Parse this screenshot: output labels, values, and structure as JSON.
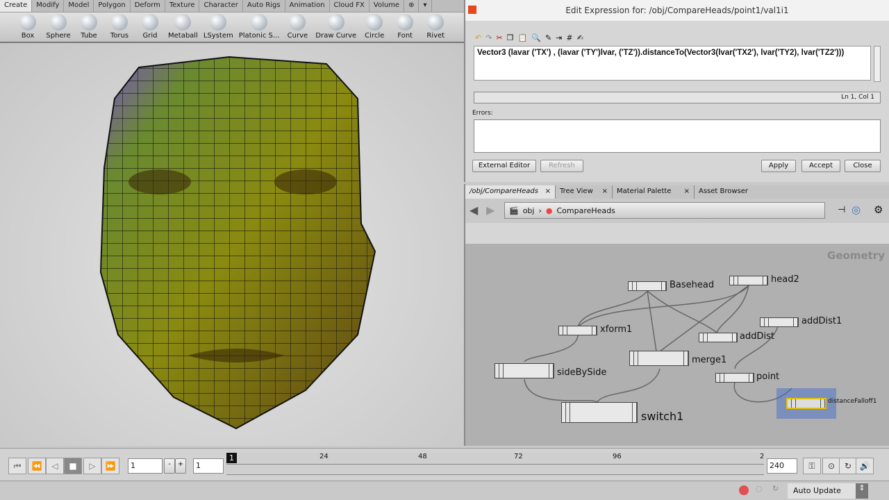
{
  "shelf": {
    "tabs": [
      "Create",
      "Modify",
      "Model",
      "Polygon",
      "Deform",
      "Texture",
      "Character",
      "Auto Rigs",
      "Animation",
      "Cloud FX",
      "Volume"
    ],
    "tools": [
      "Box",
      "Sphere",
      "Tube",
      "Torus",
      "Grid",
      "Metaball",
      "LSystem",
      "Platonic S...",
      "Curve",
      "Draw Curve",
      "Circle",
      "Font",
      "Rivet"
    ]
  },
  "expression_editor": {
    "title": "Edit Expression for: /obj/CompareHeads/point1/val1i1",
    "expression": "Vector3 (lavar ('TX') , (lavar ('TY')lvar, ('TZ')).distanceTo(Vector3(lvar('TX2'), lvar('TY2), lvar('TZ2')))",
    "cursor_status": "Ln 1, Col 1",
    "errors_label": "Errors:",
    "errors": "",
    "buttons": {
      "external_editor": "External Editor",
      "refresh": "Refresh",
      "apply": "Apply",
      "accept": "Accept",
      "close": "Close"
    }
  },
  "network": {
    "tabs": [
      "/obj/CompareHeads",
      "Tree View",
      "Material Palette",
      "Asset Browser"
    ],
    "path": [
      "obj",
      "CompareHeads"
    ],
    "context_label": "Geometry",
    "nodes": [
      {
        "name": "Basehead"
      },
      {
        "name": "head2"
      },
      {
        "name": "xform1"
      },
      {
        "name": "addDist1"
      },
      {
        "name": "addDist"
      },
      {
        "name": "merge1"
      },
      {
        "name": "sideBySide"
      },
      {
        "name": "point"
      },
      {
        "name": "switch1"
      },
      {
        "name": "distanceFalloff1"
      }
    ]
  },
  "timeline": {
    "current_frame": "1",
    "start_frame": "1",
    "end_frame": "240",
    "ticks": [
      "1",
      "24",
      "48",
      "72",
      "96",
      "2"
    ],
    "minus": "-",
    "plus": "+"
  },
  "status": {
    "update_mode": "Auto Update"
  }
}
